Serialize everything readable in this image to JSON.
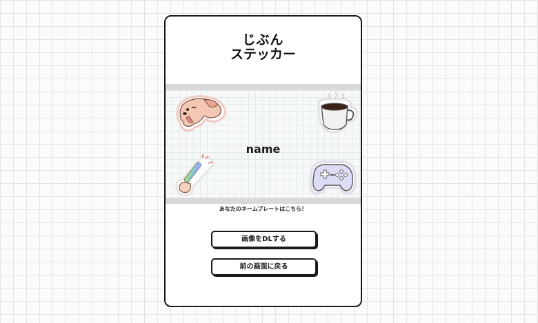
{
  "logo": {
    "line1": "じぶん",
    "line2": "ステッカー"
  },
  "plate": {
    "name": "name",
    "stickers": [
      "dog-sticker",
      "coffee-sticker",
      "penlight-sticker",
      "gamepad-sticker"
    ]
  },
  "caption": "あなたのネームプレートはこちら！",
  "buttons": {
    "download": "画像をDLする",
    "back": "前の画面に戻る"
  },
  "colors": {
    "border": "#1a1a1a",
    "band": "#d9d9d9",
    "page_grid": "#e3e3e3"
  }
}
